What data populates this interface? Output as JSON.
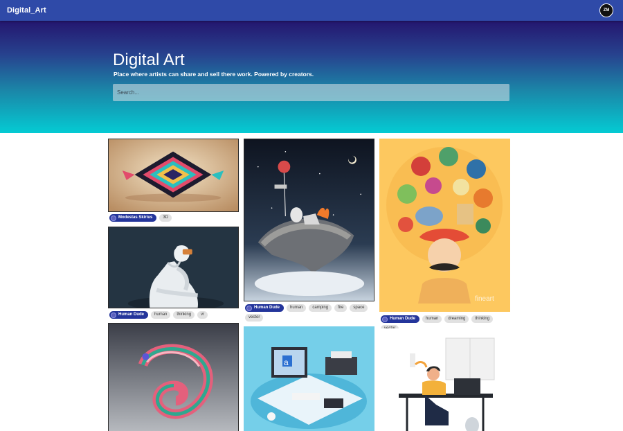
{
  "navbar": {
    "brand": "Digital_Art",
    "avatar_initials": "ZM"
  },
  "hero": {
    "title": "Digital Art",
    "subtitle": "Place where artists can share and sell there work. Powered by creators.",
    "search_placeholder": "Search..."
  },
  "colors": {
    "navbar": "#2f4aa8",
    "hero_top": "#24166f",
    "hero_bottom": "#04cbd3",
    "author_chip": "#24359b",
    "tag_chip": "#e1e1e1"
  },
  "gallery": {
    "cards": [
      {
        "author": "Modestas Skirius",
        "tags": [
          "3D"
        ]
      },
      {
        "author": "Human Dude",
        "tags": [
          "human",
          "thinking",
          "vr"
        ]
      },
      {
        "author": "Human Dude",
        "tags": [
          "human",
          "camping",
          "fire",
          "space",
          "vector"
        ]
      },
      {
        "author": "Human Dude",
        "tags": [
          "human",
          "dreaming",
          "thinking",
          "vector"
        ]
      }
    ]
  }
}
